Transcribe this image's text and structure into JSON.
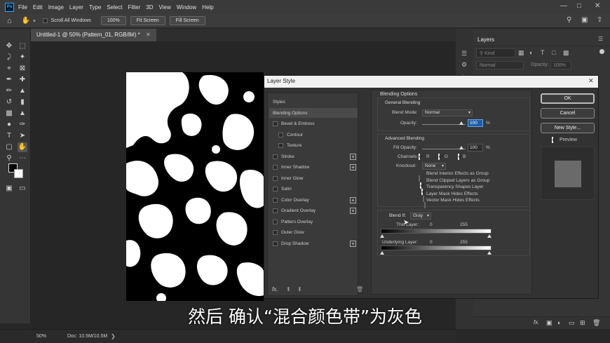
{
  "menubar": {
    "items": [
      "File",
      "Edit",
      "Image",
      "Layer",
      "Type",
      "Select",
      "Filter",
      "3D",
      "View",
      "Window",
      "Help"
    ]
  },
  "options": {
    "scroll_all": "Scroll All Windows",
    "zoom": "100%",
    "fit_screen": "Fit Screen",
    "fill_screen": "Fill Screen"
  },
  "document": {
    "tab_title": "Untitled-1 @ 50% (Pattern_01, RGB/8#) *",
    "zoom": "50%",
    "doc_size": "Doc: 10.5M/10.5M"
  },
  "layers_panel": {
    "title": "Layers",
    "kind_placeholder": "Kind",
    "blend_mode": "Normal",
    "opacity_label": "Opacity:",
    "opacity_value": "100%"
  },
  "dialog": {
    "title": "Layer Style",
    "styles_header": "Styles",
    "styles": [
      {
        "label": "Blending Options",
        "checkbox": false,
        "plus": false,
        "active": true,
        "indent": false
      },
      {
        "label": "Bevel & Emboss",
        "checkbox": true,
        "plus": false,
        "indent": false
      },
      {
        "label": "Contour",
        "checkbox": true,
        "plus": false,
        "indent": true
      },
      {
        "label": "Texture",
        "checkbox": true,
        "plus": false,
        "indent": true
      },
      {
        "label": "Stroke",
        "checkbox": true,
        "plus": true,
        "indent": false
      },
      {
        "label": "Inner Shadow",
        "checkbox": true,
        "plus": true,
        "indent": false
      },
      {
        "label": "Inner Glow",
        "checkbox": true,
        "plus": false,
        "indent": false
      },
      {
        "label": "Satin",
        "checkbox": true,
        "plus": false,
        "indent": false
      },
      {
        "label": "Color Overlay",
        "checkbox": true,
        "plus": true,
        "indent": false
      },
      {
        "label": "Gradient Overlay",
        "checkbox": true,
        "plus": true,
        "indent": false
      },
      {
        "label": "Pattern Overlay",
        "checkbox": true,
        "plus": false,
        "indent": false
      },
      {
        "label": "Outer Glow",
        "checkbox": true,
        "plus": false,
        "indent": false
      },
      {
        "label": "Drop Shadow",
        "checkbox": true,
        "plus": true,
        "indent": false
      }
    ],
    "fx_label": "fx.",
    "blending_options_title": "Blending Options",
    "general_title": "General Blending",
    "blend_mode_label": "Blend Mode:",
    "blend_mode_value": "Normal",
    "opacity_label": "Opacity:",
    "opacity_value": "100",
    "fill_opacity_label": "Fill Opacity:",
    "fill_opacity_value": "100",
    "percent": "%",
    "advanced_title": "Advanced Blending",
    "channels_label": "Channels:",
    "channel_r": "R",
    "channel_g": "G",
    "channel_b": "B",
    "knockout_label": "Knockout:",
    "knockout_value": "None",
    "options": [
      {
        "label": "Blend Interior Effects as Group",
        "checked": false
      },
      {
        "label": "Blend Clipped Layers as Group",
        "checked": true
      },
      {
        "label": "Transparency Shapes Layer",
        "checked": true
      },
      {
        "label": "Layer Mask Hides Effects",
        "checked": false
      },
      {
        "label": "Vector Mask Hides Effects",
        "checked": false
      }
    ],
    "blend_if_label": "Blend If:",
    "blend_if_value": "Gray",
    "this_layer_label": "This Layer:",
    "this_layer_min": "0",
    "this_layer_max": "255",
    "underlying_label": "Underlying Layer:",
    "underlying_min": "0",
    "underlying_max": "255",
    "ok": "OK",
    "cancel": "Cancel",
    "new_style": "New Style...",
    "preview": "Preview"
  },
  "subtitle": "然后 确认“混合颜色带”为灰色"
}
